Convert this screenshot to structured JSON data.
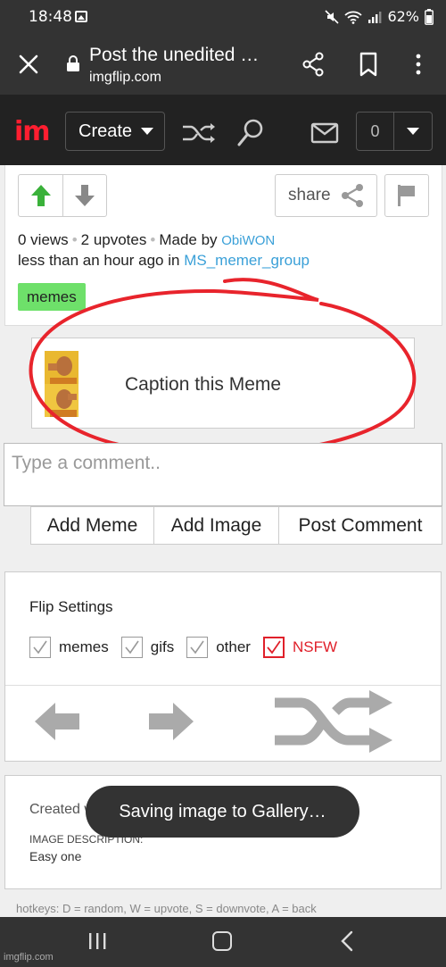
{
  "status_bar": {
    "time": "18:48",
    "battery": "62%"
  },
  "browser": {
    "title": "Post the unedited …",
    "url": "imgflip.com"
  },
  "nav": {
    "logo": "im",
    "create_label": "Create",
    "notification_count": "0"
  },
  "post": {
    "share_label": "share",
    "views": "0 views",
    "upvotes": "2 upvotes",
    "made_by_prefix": "Made by",
    "author": "ObiWON",
    "time_prefix": "less than an hour ago in",
    "stream": "MS_memer_group",
    "tag": "memes"
  },
  "caption": {
    "label": "Caption this Meme"
  },
  "comment": {
    "placeholder": "Type a comment..",
    "buttons": [
      "Add Meme",
      "Add Image",
      "Post Comment"
    ]
  },
  "flip_settings": {
    "heading": "Flip Settings",
    "options": [
      {
        "label": "memes",
        "checked": true
      },
      {
        "label": "gifs",
        "checked": true
      },
      {
        "label": "other",
        "checked": true
      },
      {
        "label": "NSFW",
        "checked": true
      }
    ]
  },
  "description": {
    "created_with": "Created with",
    "label": "IMAGE DESCRIPTION:",
    "text": "Easy one"
  },
  "hotkeys": "hotkeys: D = random, W = upvote, S = downvote, A = back",
  "toast": "Saving image to Gallery…",
  "watermark": "imgflip.com",
  "colors": {
    "brand_red": "#ff1e30",
    "tag_green": "#6ee06a",
    "link_blue": "#3aa0d8",
    "nsfw_red": "#e0202a",
    "annotation_red": "#e8242c"
  }
}
